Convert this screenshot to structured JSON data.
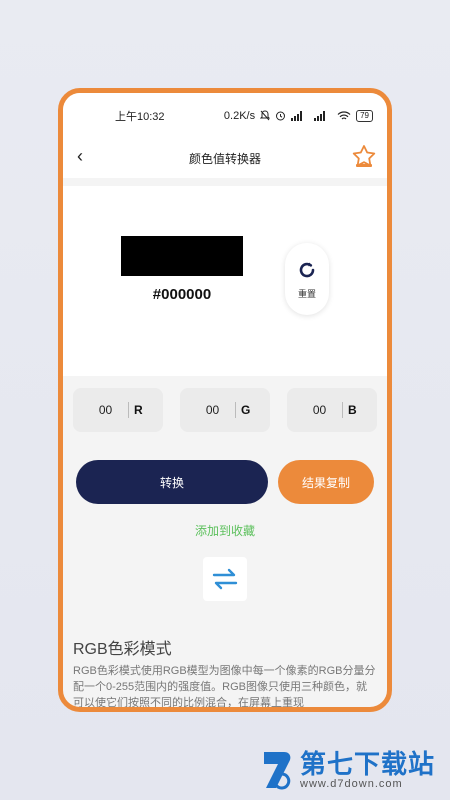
{
  "status_bar": {
    "time": "上午10:32",
    "speed": "0.2K/s",
    "battery": "79"
  },
  "nav": {
    "title": "颜色值转换器"
  },
  "preview": {
    "swatch_color": "#000000",
    "hex": "#000000",
    "reset_label": "重置"
  },
  "rgb": [
    {
      "value": "00",
      "letter": "R"
    },
    {
      "value": "00",
      "letter": "G"
    },
    {
      "value": "00",
      "letter": "B"
    }
  ],
  "actions": {
    "convert_label": "转换",
    "copy_label": "结果复制",
    "favorite_label": "添加到收藏"
  },
  "info": {
    "title": "RGB色彩模式",
    "text": "RGB色彩模式使用RGB模型为图像中每一个像素的RGB分量分配一个0-255范围内的强度值。RGB图像只使用三种颜色，就可以使它们按照不同的比例混合，在屏幕上重现"
  },
  "watermark": {
    "name": "第七下载站",
    "url": "www.d7down.com"
  },
  "colors": {
    "accent": "#ec8a3b",
    "navy": "#1b2452",
    "green": "#5cc05c"
  }
}
